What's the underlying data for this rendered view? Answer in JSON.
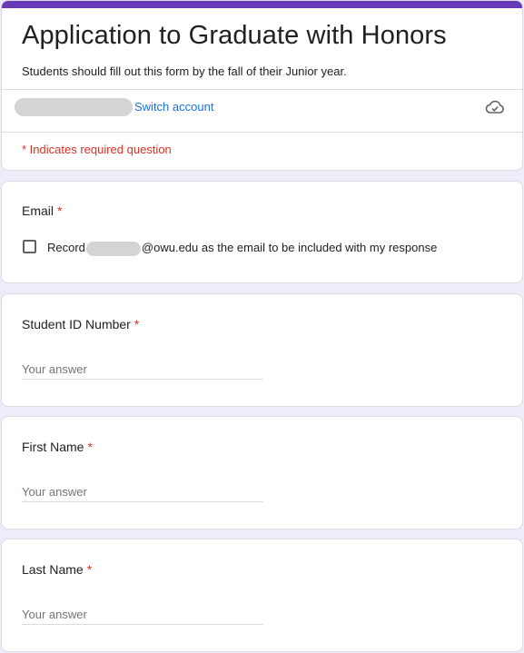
{
  "header": {
    "title": "Application to Graduate with Honors",
    "description": "Students should fill out this form by the fall of their Junior year.",
    "switch_account_label": "Switch account",
    "required_note": "* Indicates required question",
    "cloud_icon": "cloud-saved-icon",
    "accent_color": "#673ab7"
  },
  "questions": {
    "email": {
      "title": "Email",
      "required_mark": "*",
      "record_prefix": "Record",
      "record_domain": "@owu.edu",
      "record_suffix": " as the email to be included with my response",
      "checked": false
    },
    "student_id": {
      "title": "Student ID Number",
      "required_mark": "*",
      "placeholder": "Your answer",
      "value": ""
    },
    "first_name": {
      "title": "First Name",
      "required_mark": "*",
      "placeholder": "Your answer",
      "value": ""
    },
    "last_name": {
      "title": "Last Name",
      "required_mark": "*",
      "placeholder": "Your answer",
      "value": ""
    }
  },
  "colors": {
    "background": "#f0ebf8",
    "link": "#1a73e8",
    "required": "#d93025"
  }
}
